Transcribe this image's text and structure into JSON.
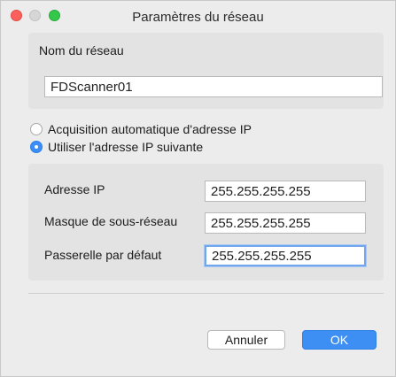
{
  "window": {
    "title": "Paramètres du réseau"
  },
  "network_name": {
    "label": "Nom du réseau",
    "value": "FDScanner01"
  },
  "ip_mode": {
    "options": [
      {
        "label": "Acquisition automatique d'adresse IP",
        "selected": false
      },
      {
        "label": "Utiliser l'adresse IP suivante",
        "selected": true
      }
    ]
  },
  "ip_settings": {
    "ip_address": {
      "label": "Adresse IP",
      "value": "255.255.255.255"
    },
    "subnet_mask": {
      "label": "Masque de sous-réseau",
      "value": "255.255.255.255"
    },
    "gateway": {
      "label": "Passerelle par défaut",
      "value": "255.255.255.255"
    }
  },
  "buttons": {
    "cancel": "Annuler",
    "ok": "OK"
  },
  "colors": {
    "accent": "#3d8ff4",
    "close": "#fc605c",
    "maximize": "#34c84a",
    "window_bg": "#ececec"
  }
}
